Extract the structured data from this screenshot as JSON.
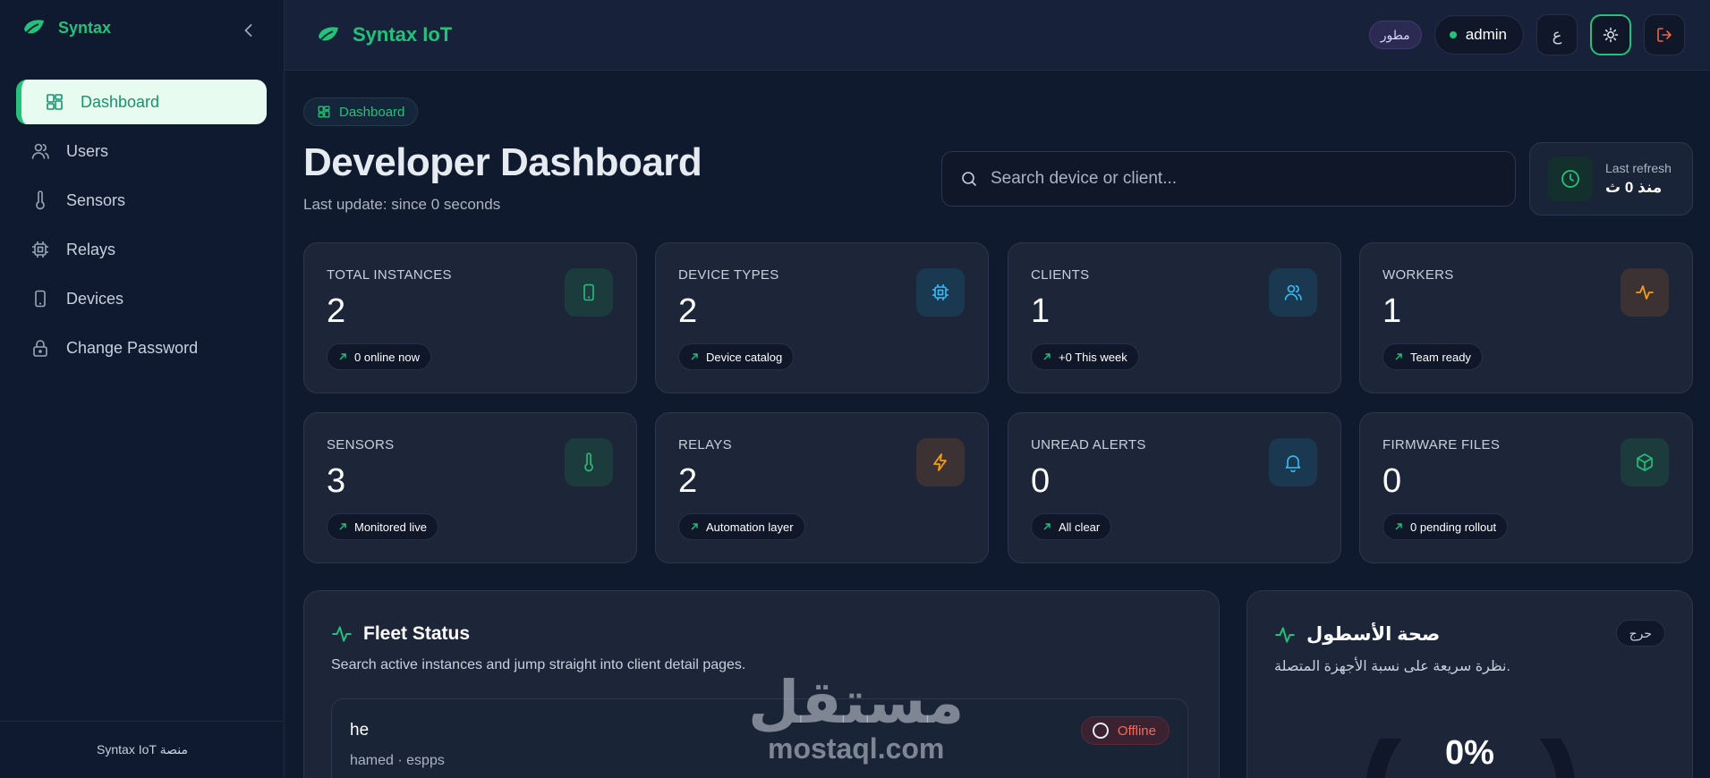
{
  "sidebar": {
    "brand": "Syntax",
    "items": [
      {
        "label": "Dashboard",
        "icon": "dashboard-icon",
        "active": true
      },
      {
        "label": "Users",
        "icon": "users-icon"
      },
      {
        "label": "Sensors",
        "icon": "thermometer-icon"
      },
      {
        "label": "Relays",
        "icon": "chip-icon"
      },
      {
        "label": "Devices",
        "icon": "device-icon"
      },
      {
        "label": "Change Password",
        "icon": "lock-icon"
      }
    ],
    "footer": "Syntax IoT منصة"
  },
  "topbar": {
    "brand": "Syntax IoT",
    "role_badge": "مطور",
    "user": "admin",
    "lang_button": "ع"
  },
  "main": {
    "breadcrumb": "Dashboard",
    "title": "Developer Dashboard",
    "subtitle": "Last update: since 0 seconds",
    "search_placeholder": "Search device or client...",
    "refresh": {
      "label": "Last refresh",
      "value": "منذ 0 ث"
    }
  },
  "stats": [
    {
      "label": "TOTAL INSTANCES",
      "value": "2",
      "badge": "0 online now",
      "icon": "tablet-icon",
      "tone": "green"
    },
    {
      "label": "DEVICE TYPES",
      "value": "2",
      "badge": "Device catalog",
      "icon": "chip-icon",
      "tone": "blue"
    },
    {
      "label": "CLIENTS",
      "value": "1",
      "badge": "+0 This week",
      "icon": "users-icon",
      "tone": "blue"
    },
    {
      "label": "WORKERS",
      "value": "1",
      "badge": "Team ready",
      "icon": "activity-icon",
      "tone": "amber"
    },
    {
      "label": "SENSORS",
      "value": "3",
      "badge": "Monitored live",
      "icon": "thermometer-icon",
      "tone": "green"
    },
    {
      "label": "RELAYS",
      "value": "2",
      "badge": "Automation layer",
      "icon": "bolt-icon",
      "tone": "amber"
    },
    {
      "label": "UNREAD ALERTS",
      "value": "0",
      "badge": "All clear",
      "icon": "bell-icon",
      "tone": "blue"
    },
    {
      "label": "FIRMWARE FILES",
      "value": "0",
      "badge": "0 pending rollout",
      "icon": "package-icon",
      "tone": "green"
    }
  ],
  "fleet": {
    "title": "Fleet Status",
    "subtitle": "Search active instances and jump straight into client detail pages.",
    "items": [
      {
        "name": "he",
        "meta": "hamed · espps",
        "status": "Offline"
      }
    ]
  },
  "health": {
    "title": "صحة الأسطول",
    "subtitle": "نظرة سريعة على نسبة الأجهزة المتصلة.",
    "chip": "حرج",
    "percent": "0%"
  },
  "watermark": {
    "arabic": "مستقل",
    "latin": "mostaql.com"
  },
  "colors": {
    "accent": "#22c27a",
    "background": "#101a2e",
    "card": "#1c2638",
    "danger": "#f26b5a"
  }
}
